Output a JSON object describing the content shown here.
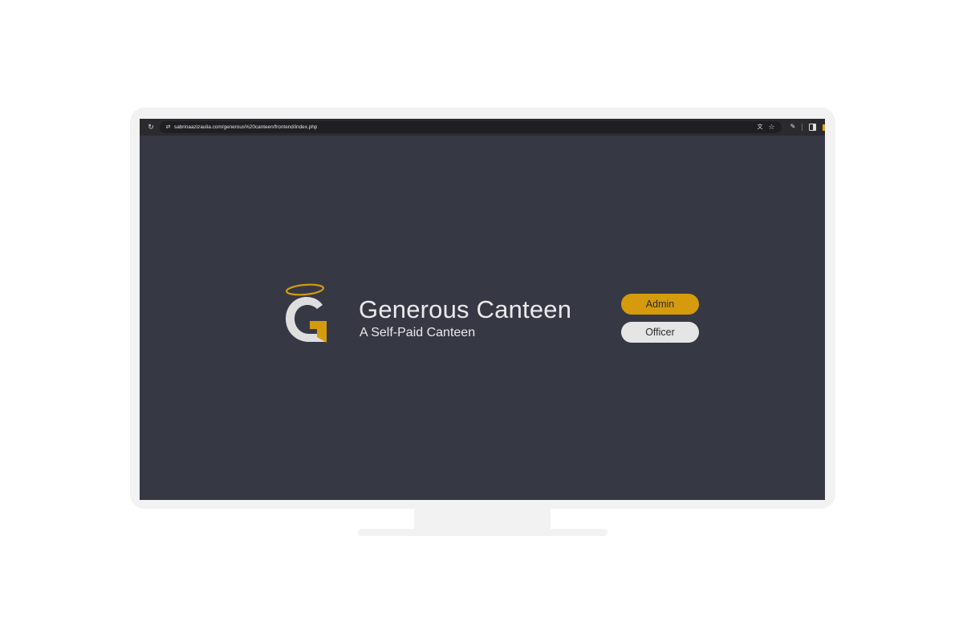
{
  "browser": {
    "url": "sabrinaazizaulia.com/generous%20canteen/frontend/index.php",
    "icons": [
      "reload-icon",
      "site-info-icon",
      "translate-icon",
      "star-icon",
      "extensions-icon",
      "side-panel-icon"
    ]
  },
  "brand": {
    "title": "Generous Canteen",
    "subtitle": "A Self-Paid Canteen",
    "logo_letter": "G"
  },
  "actions": {
    "admin_label": "Admin",
    "officer_label": "Officer"
  },
  "colors": {
    "background": "#363944",
    "accent": "#d59b0c",
    "secondary_button": "#e5e5e5",
    "text": "#e9e9ea",
    "monitor": "#f2f2f2"
  }
}
